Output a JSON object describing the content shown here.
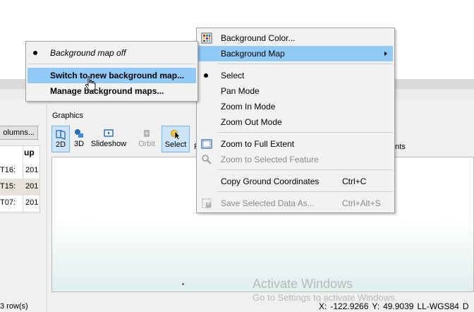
{
  "left_pane": {
    "columns_button": "olumns...",
    "table_header": "up",
    "rows": [
      {
        "c1": "T16:",
        "c2": "201"
      },
      {
        "c1": "T15:",
        "c2": "201"
      },
      {
        "c1": "T07:",
        "c2": "201"
      }
    ],
    "row_count": "3 row(s)"
  },
  "graphics": {
    "label": "Graphics",
    "toolbar": {
      "btn_2d": "2D",
      "btn_3d": "3D",
      "btn_slideshow": "Slideshow",
      "btn_orbit": "Orbit",
      "btn_select": "Select",
      "cut_label": "F",
      "right_cut_label": "nts"
    }
  },
  "status_bar": {
    "x_label": "X:",
    "x_value": "-122.9266",
    "y_label": "Y:",
    "y_value": "49.9039",
    "crs": "LL-WGS84",
    "trailing": "D"
  },
  "watermark": {
    "title": "Activate Windows",
    "subtitle": "Go to Settings to activate Windows."
  },
  "context_menu": {
    "background_color": "Background Color...",
    "background_map": "Background Map",
    "select": "Select",
    "pan_mode": "Pan Mode",
    "zoom_in_mode": "Zoom In Mode",
    "zoom_out_mode": "Zoom Out Mode",
    "zoom_full_extent": "Zoom to Full Extent",
    "zoom_selected_feature": "Zoom to Selected Feature",
    "copy_ground_coords": "Copy Ground Coordinates",
    "copy_ground_coords_shortcut": "Ctrl+C",
    "save_selected_data": "Save Selected Data As...",
    "save_selected_data_shortcut": "Ctrl+Alt+S"
  },
  "submenu": {
    "background_map_off": "Background map off",
    "switch_new_map": "Switch to new background map...",
    "manage_maps": "Manage background maps..."
  },
  "colors": {
    "menu_highlight": "#91c9f7",
    "menu_background": "#f2f2f2",
    "active_tool": "#cce4f7"
  }
}
